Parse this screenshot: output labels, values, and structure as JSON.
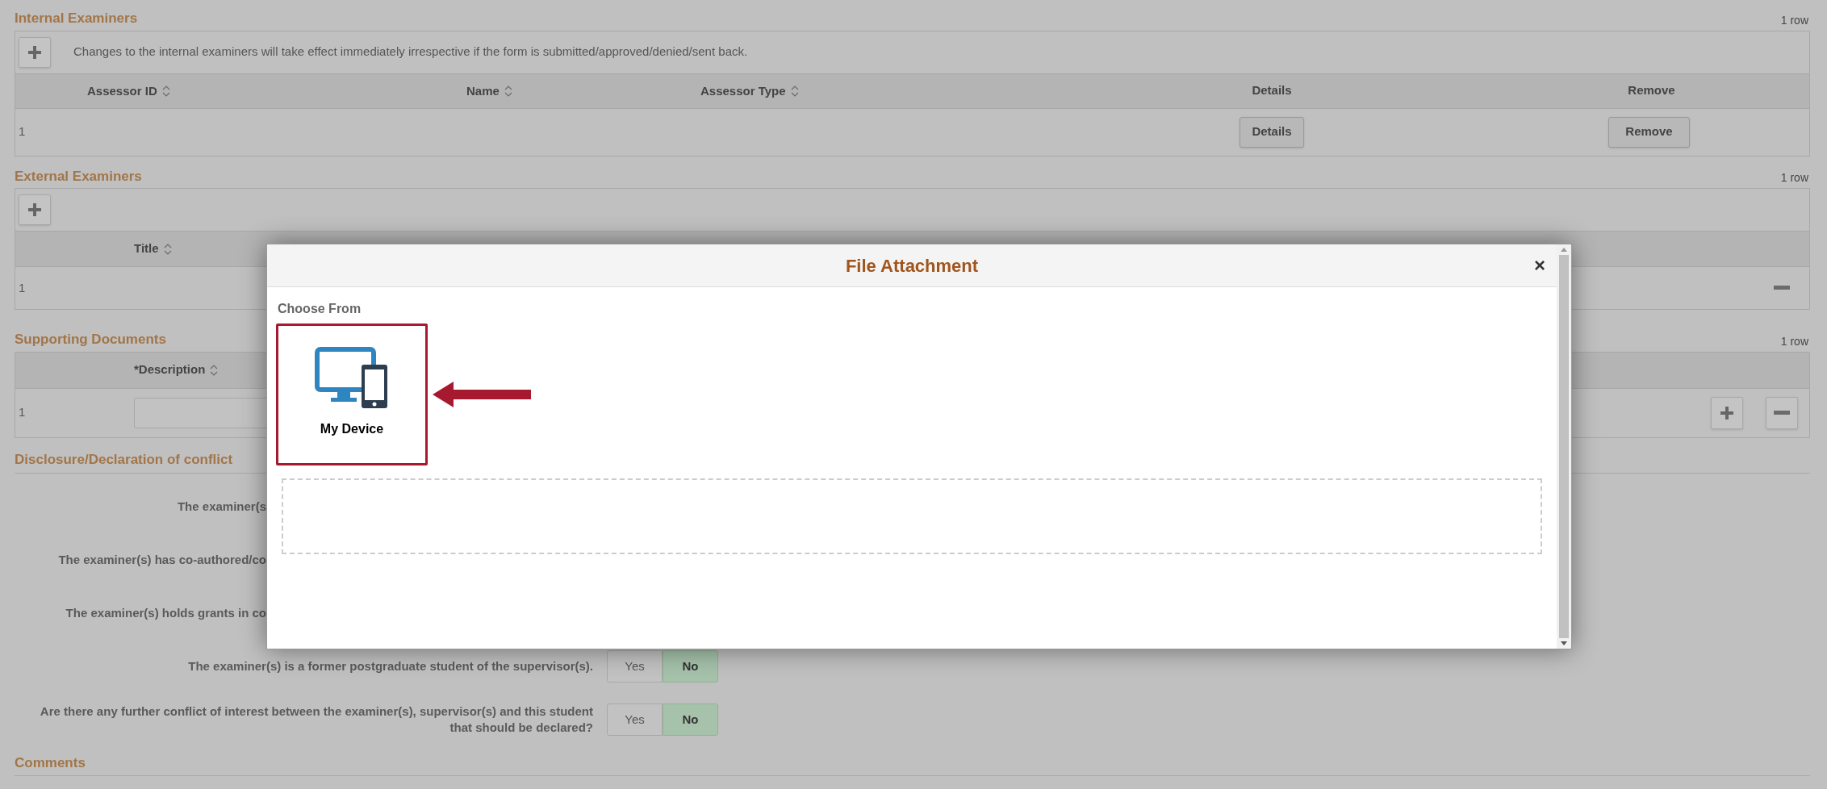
{
  "internal_examiners": {
    "title": "Internal Examiners",
    "row_count": "1 row",
    "note": "Changes to the internal examiners will take effect immediately irrespective if the form is submitted/approved/denied/sent back.",
    "columns": [
      {
        "label": "Assessor ID",
        "sortable": true
      },
      {
        "label": "Name",
        "sortable": true
      },
      {
        "label": "Assessor Type",
        "sortable": true
      },
      {
        "label": "Details",
        "sortable": false
      },
      {
        "label": "Remove",
        "sortable": false
      }
    ],
    "rows": [
      {
        "row_number": "1",
        "details_button": "Details",
        "remove_button": "Remove"
      }
    ]
  },
  "external_examiners": {
    "title": "External Examiners",
    "row_count": "1 row",
    "columns": [
      {
        "label": "Title",
        "sortable": true
      }
    ],
    "rows": [
      {
        "row_number": "1"
      }
    ]
  },
  "supporting_documents": {
    "title": "Supporting Documents",
    "row_count": "1 row",
    "columns": [
      {
        "label": "*Description",
        "sortable": true
      }
    ],
    "rows": [
      {
        "row_number": "1"
      }
    ]
  },
  "disclosure": {
    "title": "Disclosure/Declaration of conflict",
    "questions": [
      {
        "label": "The examiner(s"
      },
      {
        "label": "The examiner(s) has co-authored/co"
      },
      {
        "label": "The examiner(s) holds grants in co"
      },
      {
        "label": "The examiner(s) is a former postgraduate student of the supervisor(s).",
        "options": [
          {
            "label": "Yes",
            "selected": false
          },
          {
            "label": "No",
            "selected": true
          }
        ]
      },
      {
        "label": "Are there any further conflict of interest between the examiner(s), supervisor(s) and this student that should be declared?",
        "options": [
          {
            "label": "Yes",
            "selected": false
          },
          {
            "label": "No",
            "selected": true
          }
        ]
      }
    ]
  },
  "comments": {
    "title": "Comments"
  },
  "dialog": {
    "title": "File Attachment",
    "close": "×",
    "choose_from": "Choose From",
    "sources": [
      {
        "label": "My Device",
        "highlighted": true
      }
    ]
  }
}
